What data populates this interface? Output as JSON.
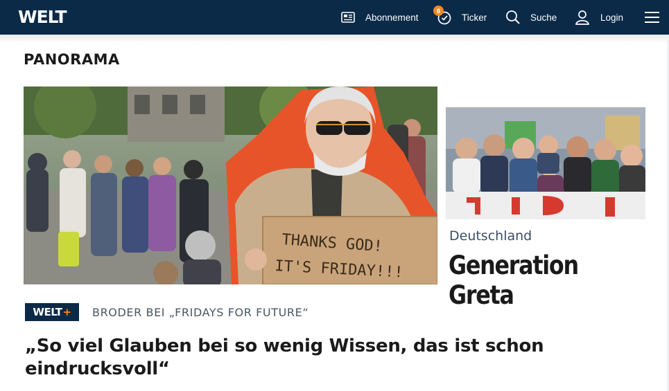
{
  "header": {
    "logo": "WELT",
    "nav": [
      {
        "label": "Abonnement",
        "icon": "newspaper-icon"
      },
      {
        "label": "Ticker",
        "icon": "ticker-clock-icon",
        "badge": "8"
      },
      {
        "label": "Suche",
        "icon": "search-icon"
      },
      {
        "label": "Login",
        "icon": "user-icon"
      }
    ],
    "menu_icon": "hamburger-menu-icon"
  },
  "section": {
    "title": "PANORAMA"
  },
  "main_teaser": {
    "image_sign_text": [
      "THANKS GOD!",
      "IT'S FRIDAY!!!"
    ],
    "premium_badge": {
      "text": "WELT",
      "plus": "+"
    },
    "kicker": "BRODER BEI „FRIDAYS FOR FUTURE“",
    "headline": "„So viel Glauben bei so wenig Wissen, das ist schon eindrucksvoll“"
  },
  "side_teaser": {
    "kicker": "Deutschland",
    "headline": "Generation Greta"
  },
  "colors": {
    "header_bg": "#0a2a47",
    "badge": "#f08a24",
    "kicker_blue": "#3b4f63",
    "accent_orange": "#e8542a"
  }
}
